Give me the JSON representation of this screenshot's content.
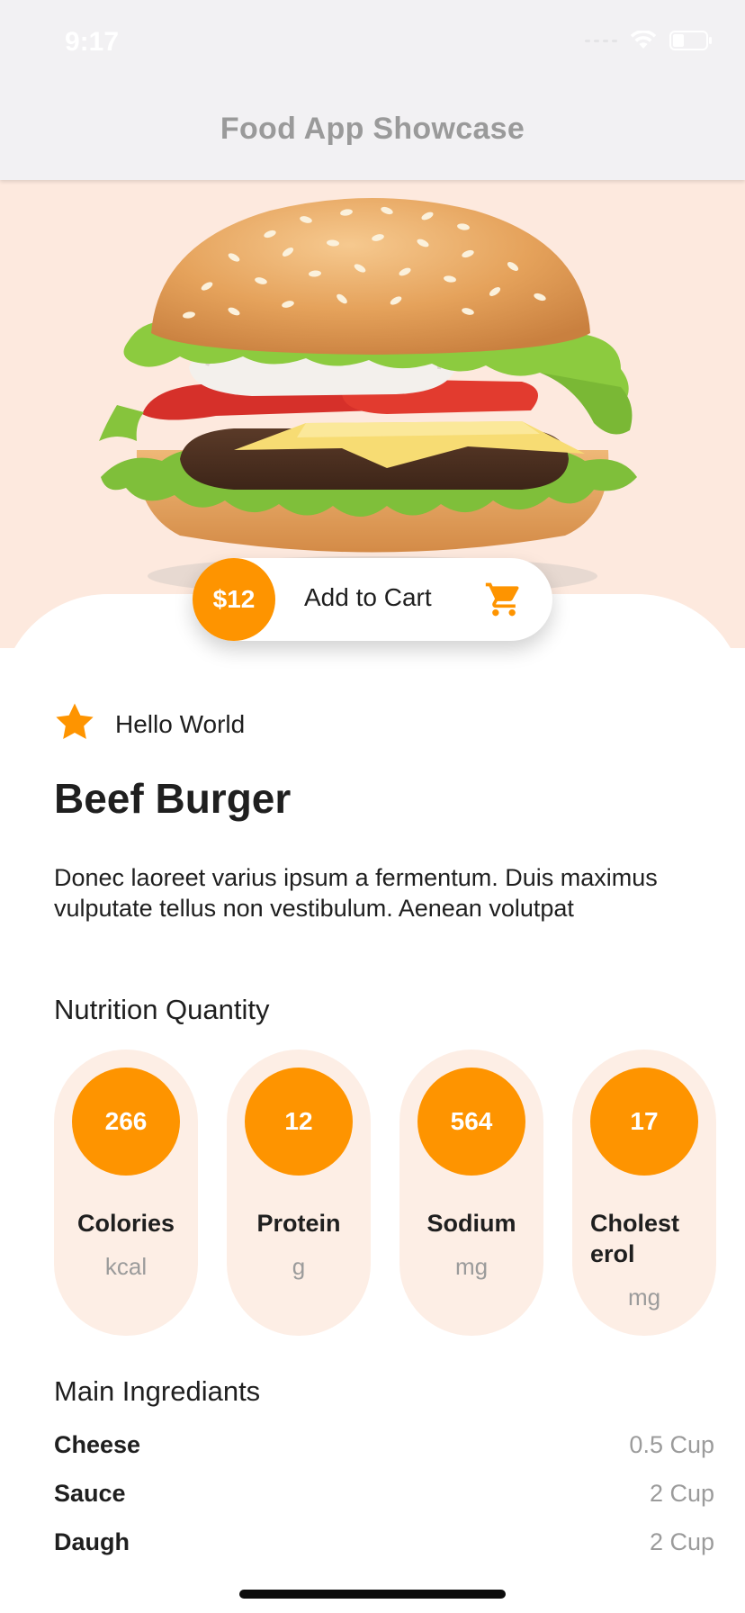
{
  "status_bar": {
    "time": "9:17"
  },
  "nav": {
    "title": "Food App Showcase"
  },
  "cart": {
    "price": "$12",
    "label": "Add to Cart"
  },
  "rating": {
    "text": "Hello World"
  },
  "product": {
    "title": "Beef Burger",
    "description": "Donec laoreet varius ipsum a fermentum. Duis maximus vulputate tellus non vestibulum. Aenean volutpat"
  },
  "nutrition": {
    "heading": "Nutrition Quantity",
    "items": [
      {
        "value": "266",
        "name": "Colories",
        "unit": "kcal"
      },
      {
        "value": "12",
        "name": "Protein",
        "unit": "g"
      },
      {
        "value": "564",
        "name": "Sodium",
        "unit": "mg"
      },
      {
        "value": "17",
        "name": "Cholesterol",
        "unit": "mg"
      }
    ]
  },
  "ingredients": {
    "heading": "Main Ingrediants",
    "items": [
      {
        "name": "Cheese",
        "qty": "0.5 Cup"
      },
      {
        "name": "Sauce",
        "qty": "2 Cup"
      },
      {
        "name": "Daugh",
        "qty": "2 Cup"
      }
    ]
  },
  "colors": {
    "accent": "#fe9400",
    "hero_bg": "#fde9de",
    "pill_bg": "#fdeee5"
  },
  "icons": [
    "wifi-icon",
    "battery-icon",
    "cart-icon",
    "star-icon",
    "burger-image"
  ]
}
